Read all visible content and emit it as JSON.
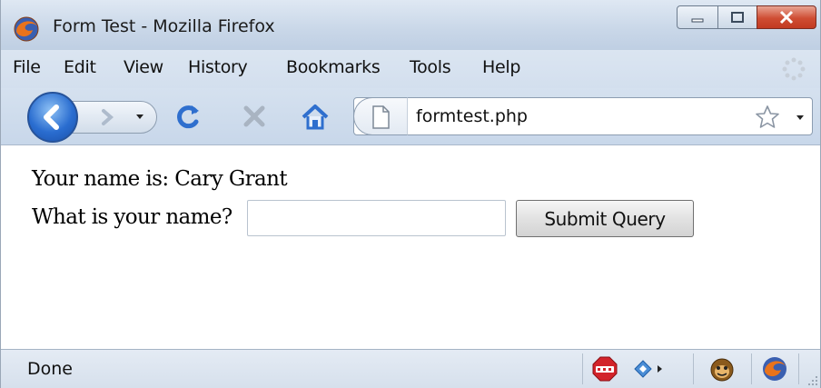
{
  "window": {
    "title": "Form Test - Mozilla Firefox",
    "buttons": [
      "minimize",
      "maximize",
      "close"
    ]
  },
  "menu": {
    "items": [
      "File",
      "Edit",
      "View",
      "History",
      "Bookmarks",
      "Tools",
      "Help"
    ]
  },
  "navigation": {
    "url": "formtest.php",
    "icons": [
      "back-icon",
      "forward-icon",
      "history-dropdown-icon",
      "reload-icon",
      "stop-icon",
      "home-icon",
      "page-icon",
      "bookmark-star-icon",
      "url-dropdown-icon"
    ]
  },
  "page": {
    "greeting": "Your name is: Cary Grant",
    "prompt": "What is your name?",
    "input_value": "",
    "submit_label": "Submit Query"
  },
  "status": {
    "text": "Done",
    "icons": [
      "adblock-plus-icon",
      "addon-arrow-icon",
      "monkey-icon",
      "firefox-icon"
    ]
  },
  "colors": {
    "chrome": "#d3dfee",
    "close_button": "#cf4d33",
    "back_button": "#2a6dd0",
    "reload": "#2f6fce",
    "home": "#3a7bd5"
  }
}
